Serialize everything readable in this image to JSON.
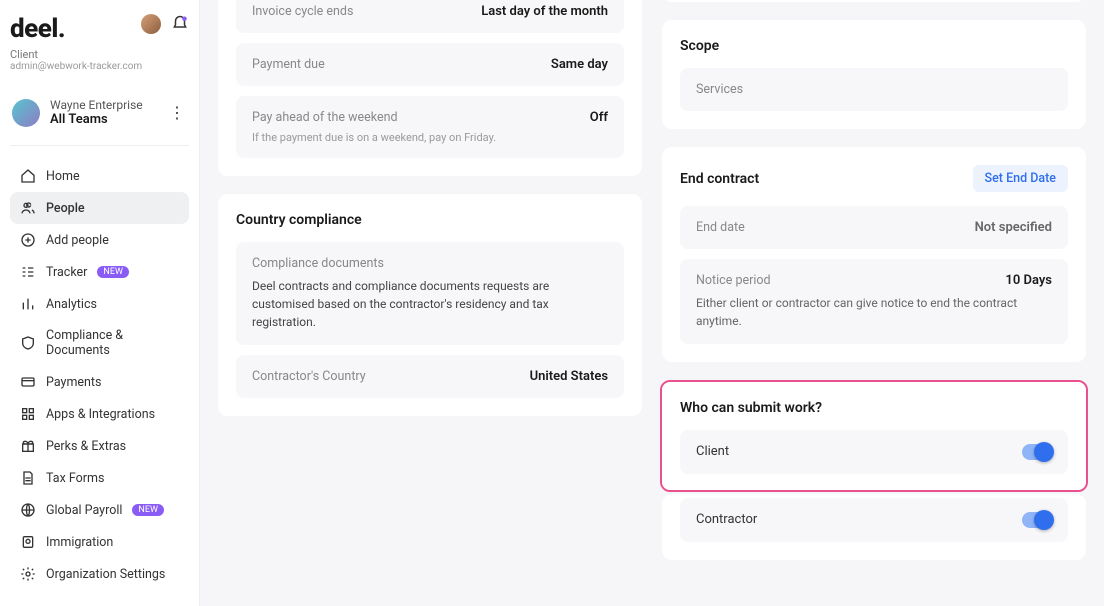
{
  "brand": "deel.",
  "role_label": "Client",
  "email": "admin@webwork-tracker.com",
  "org": {
    "name": "Wayne Enterprise",
    "team": "All Teams"
  },
  "nav": {
    "home": "Home",
    "people": "People",
    "add_people": "Add people",
    "tracker": "Tracker",
    "tracker_badge": "NEW",
    "analytics": "Analytics",
    "compliance": "Compliance & Documents",
    "payments": "Payments",
    "apps": "Apps & Integrations",
    "perks": "Perks & Extras",
    "tax": "Tax Forms",
    "global_payroll": "Global Payroll",
    "global_payroll_badge": "NEW",
    "immigration": "Immigration",
    "org_settings": "Organization Settings"
  },
  "payment_panel": {
    "invoice_cycle": {
      "label": "Invoice cycle ends",
      "value": "Last day of the month"
    },
    "payment_due": {
      "label": "Payment due",
      "value": "Same day"
    },
    "weekend": {
      "label": "Pay ahead of the weekend",
      "value": "Off",
      "note": "If the payment due is on a weekend, pay on Friday."
    }
  },
  "compliance_panel": {
    "title": "Country compliance",
    "docs_label": "Compliance documents",
    "docs_desc": "Deel contracts and compliance documents requests are customised based on the contractor's residency and tax registration.",
    "country_label": "Contractor's Country",
    "country_value": "United States"
  },
  "scope_panel": {
    "title": "Scope",
    "services": "Services"
  },
  "end_contract_panel": {
    "title": "End contract",
    "set_end_date": "Set End Date",
    "end_date_label": "End date",
    "end_date_value": "Not specified",
    "notice_label": "Notice period",
    "notice_value": "10 Days",
    "notice_desc": "Either client or contractor can give notice to end the contract anytime."
  },
  "submit_panel": {
    "title": "Who can submit work?",
    "client": "Client",
    "contractor": "Contractor"
  }
}
